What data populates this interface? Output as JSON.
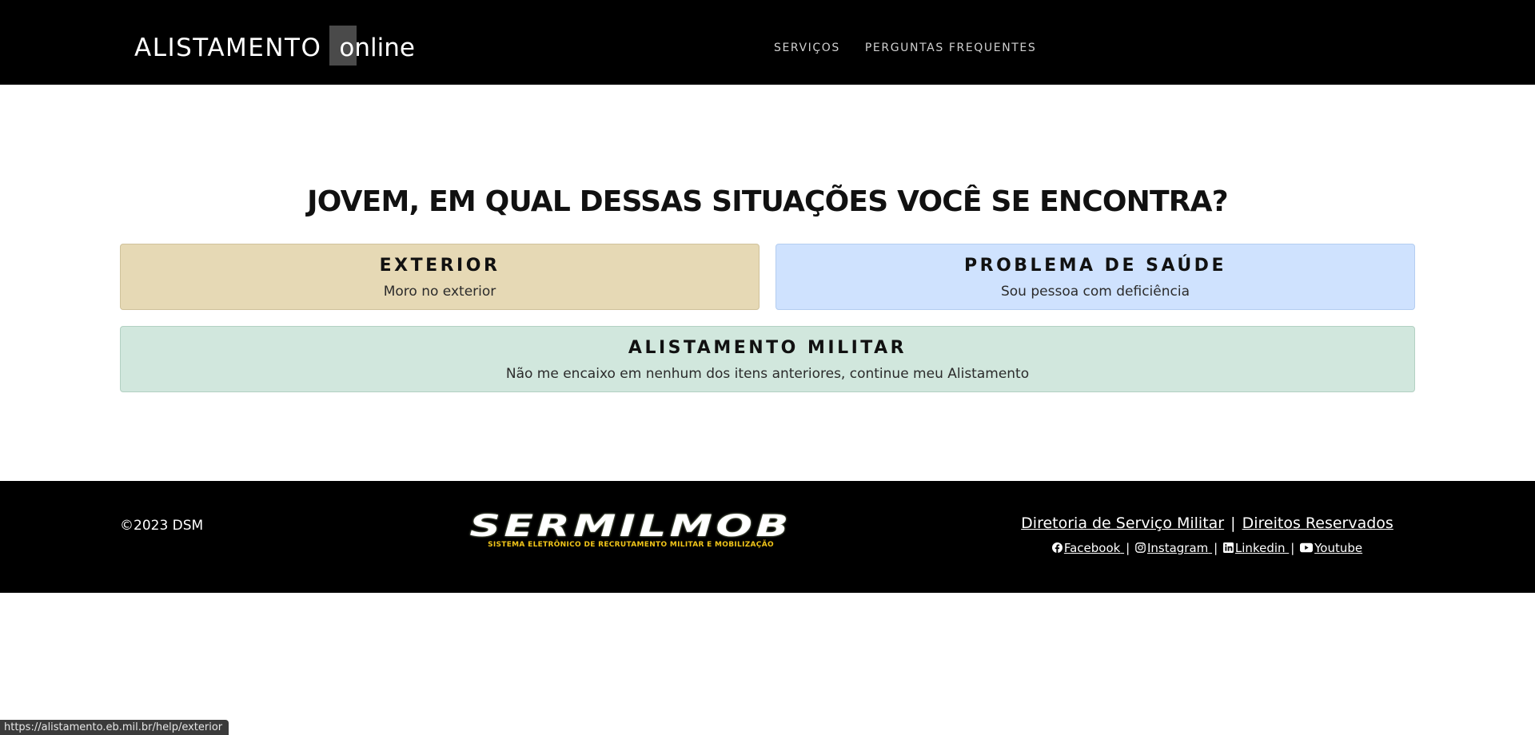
{
  "navbar": {
    "brand_main": "ALISTAMENTO",
    "brand_suffix": "online",
    "links": [
      "SERVIÇOS",
      "PERGUNTAS FREQUENTES"
    ]
  },
  "main": {
    "heading": "JOVEM, EM QUAL DESSAS SITUAÇÕES VOCÊ SE ENCONTRA?",
    "cards": [
      {
        "title": "EXTERIOR",
        "subtitle": "Moro no exterior",
        "color": "#e6d9b5"
      },
      {
        "title": "PROBLEMA DE SAÚDE",
        "subtitle": "Sou pessoa com deficiência",
        "color": "#cfe2fe"
      },
      {
        "title": "ALISTAMENTO MILITAR",
        "subtitle": "Não me encaixo em nenhum dos itens anteriores, continue meu Alistamento",
        "color": "#d1e7dd"
      }
    ]
  },
  "footer": {
    "copyright": "©2023 DSM",
    "logo_title": "SERMILMOB",
    "logo_subtitle": "SISTEMA ELETRÔNICO DE RECRUTAMENTO MILITAR E MOBILIZAÇÃO",
    "link_dsm": "Diretoria de Serviço Militar",
    "link_rights": "Direitos Reservados",
    "social": [
      {
        "label": "Facebook",
        "icon": "facebook-icon"
      },
      {
        "label": "Instagram",
        "icon": "instagram-icon"
      },
      {
        "label": "Linkedin",
        "icon": "linkedin-icon"
      },
      {
        "label": "Youtube",
        "icon": "youtube-icon"
      }
    ],
    "separator": "|"
  },
  "status_bar": {
    "url": "https://alistamento.eb.mil.br/help/exterior"
  },
  "colors": {
    "navbar_bg": "#000000",
    "footer_bg": "#000000",
    "logo_subtitle": "#f0c419"
  }
}
